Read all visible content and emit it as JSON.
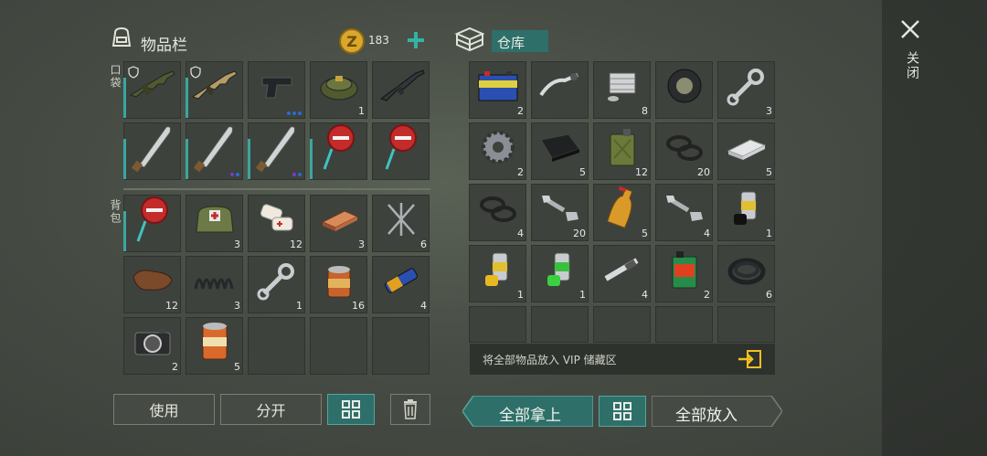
{
  "inventory": {
    "title": "物品栏",
    "coins": "183",
    "pocket_label": "口袋",
    "backpack_label": "背包",
    "pocket_slots": [
      {
        "icon": "assault-rifle-icon",
        "count": "",
        "shield": true
      },
      {
        "icon": "tan-rifle-icon",
        "count": "",
        "shield": true
      },
      {
        "icon": "pistol-icon",
        "count": ""
      },
      {
        "icon": "landmine-icon",
        "count": "1"
      },
      {
        "icon": "rifle-icon",
        "count": ""
      },
      {
        "icon": "machete-icon",
        "count": ""
      },
      {
        "icon": "machete-icon",
        "count": ""
      },
      {
        "icon": "machete-icon",
        "count": ""
      },
      {
        "icon": "stop-sign-icon",
        "count": ""
      },
      {
        "icon": "stop-sign-icon",
        "count": ""
      }
    ],
    "backpack_slots": [
      {
        "icon": "stop-sign-icon",
        "count": ""
      },
      {
        "icon": "medkit-bag-icon",
        "count": "3"
      },
      {
        "icon": "bandage-icon",
        "count": "12"
      },
      {
        "icon": "copper-ingot-icon",
        "count": "3"
      },
      {
        "icon": "nails-icon",
        "count": "6"
      },
      {
        "icon": "leather-icon",
        "count": "12"
      },
      {
        "icon": "spring-icon",
        "count": "3"
      },
      {
        "icon": "wrench-icon",
        "count": "1"
      },
      {
        "icon": "canned-food-icon",
        "count": "16"
      },
      {
        "icon": "battery-icon",
        "count": "4"
      },
      {
        "icon": "camera-icon",
        "count": "2"
      },
      {
        "icon": "food-can-icon",
        "count": "5"
      },
      {
        "icon": "",
        "count": ""
      },
      {
        "icon": "",
        "count": ""
      },
      {
        "icon": "",
        "count": ""
      }
    ]
  },
  "storage": {
    "title": "仓库",
    "slots": [
      {
        "icon": "car-battery-icon",
        "count": "2"
      },
      {
        "icon": "handlebar-icon",
        "count": ""
      },
      {
        "icon": "engine-cylinder-icon",
        "count": "8"
      },
      {
        "icon": "tire-icon",
        "count": ""
      },
      {
        "icon": "wrench-icon",
        "count": "3"
      },
      {
        "icon": "gear-icon",
        "count": "2"
      },
      {
        "icon": "rubber-sheet-icon",
        "count": "5"
      },
      {
        "icon": "jerrycan-icon",
        "count": "12"
      },
      {
        "icon": "rubber-rings-icon",
        "count": "20"
      },
      {
        "icon": "aluminum-ingot-icon",
        "count": "5"
      },
      {
        "icon": "rubber-rings-icon",
        "count": "4"
      },
      {
        "icon": "bolts-icon",
        "count": "20"
      },
      {
        "icon": "bottle-icon",
        "count": "5"
      },
      {
        "icon": "bolts-icon",
        "count": "4"
      },
      {
        "icon": "spray-can-black-icon",
        "count": "1"
      },
      {
        "icon": "spray-can-yellow-icon",
        "count": "1"
      },
      {
        "icon": "spray-can-green-icon",
        "count": "1"
      },
      {
        "icon": "spark-plug-icon",
        "count": "4"
      },
      {
        "icon": "motor-oil-icon",
        "count": "2"
      },
      {
        "icon": "hose-icon",
        "count": "6"
      }
    ],
    "vip_text": "将全部物品放入 VIP 储藏区"
  },
  "buttons": {
    "use": "使用",
    "split": "分开",
    "take_all": "全部拿上",
    "put_all": "全部放入"
  },
  "close_label": "关闭"
}
